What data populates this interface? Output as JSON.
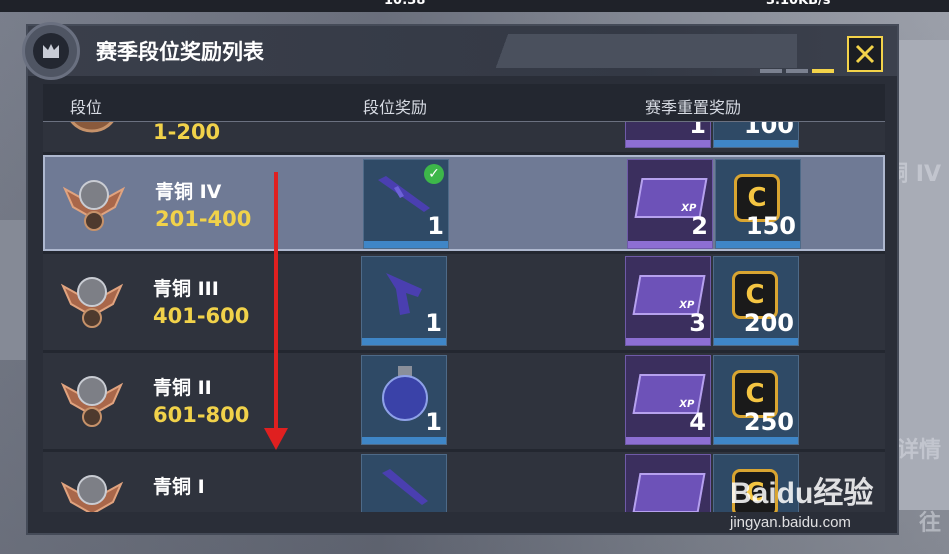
{
  "status_bar": {
    "time": "10:38",
    "network": "3.10KB/s"
  },
  "background": {
    "side_labels": [
      "铜 IV",
      "详情",
      "往"
    ]
  },
  "dialog": {
    "title": "赛季段位奖励列表",
    "close_icon": "close-x-icon",
    "pages": 3,
    "active_page": 3
  },
  "table": {
    "headers": {
      "rank": "段位",
      "rank_reward": "段位奖励",
      "reset_reward": "赛季重置奖励"
    },
    "rows": [
      {
        "name": "",
        "range": "1-200",
        "rank_reward_qty": "",
        "rank_reward_claimed": false,
        "xp_qty": "1",
        "coin_qty": "100"
      },
      {
        "name": "青铜 IV",
        "range": "201-400",
        "rank_reward_qty": "1",
        "rank_reward_claimed": true,
        "xp_qty": "2",
        "coin_qty": "150",
        "highlighted": true
      },
      {
        "name": "青铜 III",
        "range": "401-600",
        "rank_reward_qty": "1",
        "rank_reward_claimed": false,
        "xp_qty": "3",
        "coin_qty": "200"
      },
      {
        "name": "青铜 II",
        "range": "601-800",
        "rank_reward_qty": "1",
        "rank_reward_claimed": false,
        "xp_qty": "4",
        "coin_qty": "250"
      },
      {
        "name": "青铜 I",
        "range": "",
        "rank_reward_qty": "",
        "rank_reward_claimed": false,
        "xp_qty": "",
        "coin_qty": ""
      }
    ]
  },
  "reward_icons": {
    "xp_label": "XP",
    "coin_letter": "C"
  },
  "watermark": {
    "logo": "Baidu经验",
    "url": "jingyan.baidu.com"
  },
  "colors": {
    "accent_yellow": "#f3d34a",
    "highlight_row": "#6f7a95",
    "arrow_red": "#e02020"
  }
}
